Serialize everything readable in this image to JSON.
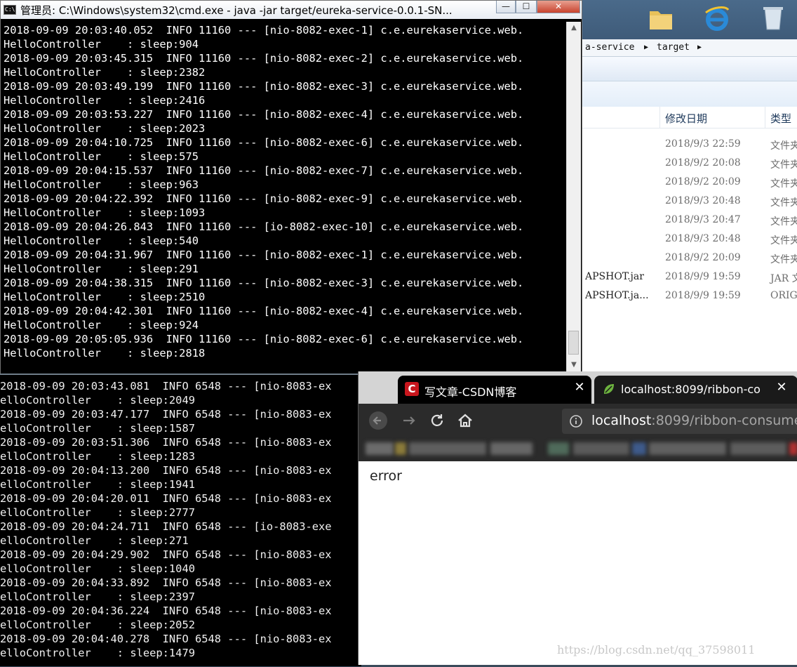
{
  "explorer": {
    "breadcrumb": [
      "a-service",
      "target"
    ],
    "columns": {
      "date": "修改日期",
      "type": "类型"
    },
    "rows": [
      {
        "name": "",
        "date": "2018/9/3 22:59",
        "type": "文件夹"
      },
      {
        "name": "",
        "date": "2018/9/2 20:08",
        "type": "文件夹"
      },
      {
        "name": "",
        "date": "2018/9/2 20:09",
        "type": "文件夹"
      },
      {
        "name": "",
        "date": "2018/9/3 20:48",
        "type": "文件夹"
      },
      {
        "name": "",
        "date": "2018/9/3 20:47",
        "type": "文件夹"
      },
      {
        "name": "",
        "date": "2018/9/3 20:48",
        "type": "文件夹"
      },
      {
        "name": "",
        "date": "2018/9/2 20:09",
        "type": "文件夹"
      },
      {
        "name": "APSHOT.jar",
        "date": "2018/9/9 19:59",
        "type": "JAR 文"
      },
      {
        "name": "APSHOT.ja...",
        "date": "2018/9/9 19:59",
        "type": "ORIGI"
      }
    ]
  },
  "cmd1": {
    "title": "管理员: C:\\Windows\\system32\\cmd.exe - java  -jar target/eureka-service-0.0.1-SN...",
    "icon_label": "C:\\",
    "buttons": {
      "minimize": "—",
      "maximize": "☐",
      "close": "✕"
    },
    "lines": [
      "2018-09-09 20:03:40.052  INFO 11160 --- [nio-8082-exec-1] c.e.eurekaservice.web.",
      "HelloController    : sleep:904",
      "2018-09-09 20:03:45.315  INFO 11160 --- [nio-8082-exec-2] c.e.eurekaservice.web.",
      "HelloController    : sleep:2382",
      "2018-09-09 20:03:49.199  INFO 11160 --- [nio-8082-exec-3] c.e.eurekaservice.web.",
      "HelloController    : sleep:2416",
      "2018-09-09 20:03:53.227  INFO 11160 --- [nio-8082-exec-4] c.e.eurekaservice.web.",
      "HelloController    : sleep:2023",
      "2018-09-09 20:04:10.725  INFO 11160 --- [nio-8082-exec-6] c.e.eurekaservice.web.",
      "HelloController    : sleep:575",
      "2018-09-09 20:04:15.537  INFO 11160 --- [nio-8082-exec-7] c.e.eurekaservice.web.",
      "HelloController    : sleep:963",
      "2018-09-09 20:04:22.392  INFO 11160 --- [nio-8082-exec-9] c.e.eurekaservice.web.",
      "HelloController    : sleep:1093",
      "2018-09-09 20:04:26.843  INFO 11160 --- [io-8082-exec-10] c.e.eurekaservice.web.",
      "HelloController    : sleep:540",
      "2018-09-09 20:04:31.967  INFO 11160 --- [nio-8082-exec-1] c.e.eurekaservice.web.",
      "HelloController    : sleep:291",
      "2018-09-09 20:04:38.315  INFO 11160 --- [nio-8082-exec-3] c.e.eurekaservice.web.",
      "HelloController    : sleep:2510",
      "2018-09-09 20:04:42.301  INFO 11160 --- [nio-8082-exec-4] c.e.eurekaservice.web.",
      "HelloController    : sleep:924",
      "2018-09-09 20:05:05.936  INFO 11160 --- [nio-8082-exec-6] c.e.eurekaservice.web.",
      "HelloController    : sleep:2818"
    ]
  },
  "cmd2": {
    "lines": [
      "2018-09-09 20:03:43.081  INFO 6548 --- [nio-8083-ex",
      "elloController    : sleep:2049",
      "2018-09-09 20:03:47.177  INFO 6548 --- [nio-8083-ex",
      "elloController    : sleep:1587",
      "2018-09-09 20:03:51.306  INFO 6548 --- [nio-8083-ex",
      "elloController    : sleep:1283",
      "2018-09-09 20:04:13.200  INFO 6548 --- [nio-8083-ex",
      "elloController    : sleep:1941",
      "2018-09-09 20:04:20.011  INFO 6548 --- [nio-8083-ex",
      "elloController    : sleep:2777",
      "2018-09-09 20:04:24.711  INFO 6548 --- [io-8083-exe",
      "elloController    : sleep:271",
      "2018-09-09 20:04:29.902  INFO 6548 --- [nio-8083-ex",
      "elloController    : sleep:1040",
      "2018-09-09 20:04:33.892  INFO 6548 --- [nio-8083-ex",
      "elloController    : sleep:2397",
      "2018-09-09 20:04:36.224  INFO 6548 --- [nio-8083-ex",
      "elloController    : sleep:2052",
      "2018-09-09 20:04:40.278  INFO 6548 --- [nio-8083-ex",
      "elloController    : sleep:1479"
    ]
  },
  "chrome": {
    "tabs": [
      {
        "title": "写文章-CSDN博客",
        "favicon": "csdn-icon",
        "favicon_letter": "C"
      },
      {
        "title": "localhost:8099/ribbon-co",
        "favicon": "spring-leaf-icon"
      }
    ],
    "close_glyph": "✕",
    "url_host": "localhost",
    "url_rest": ":8099/ribbon-consumer",
    "page_text": "error"
  },
  "watermark": "https://blog.csdn.net/qq_37598011",
  "colors": {
    "csdn_red": "#c8161d",
    "spring_green": "#6db33f",
    "console_bg": "#000000",
    "chrome_dark": "#2b2b2b"
  }
}
